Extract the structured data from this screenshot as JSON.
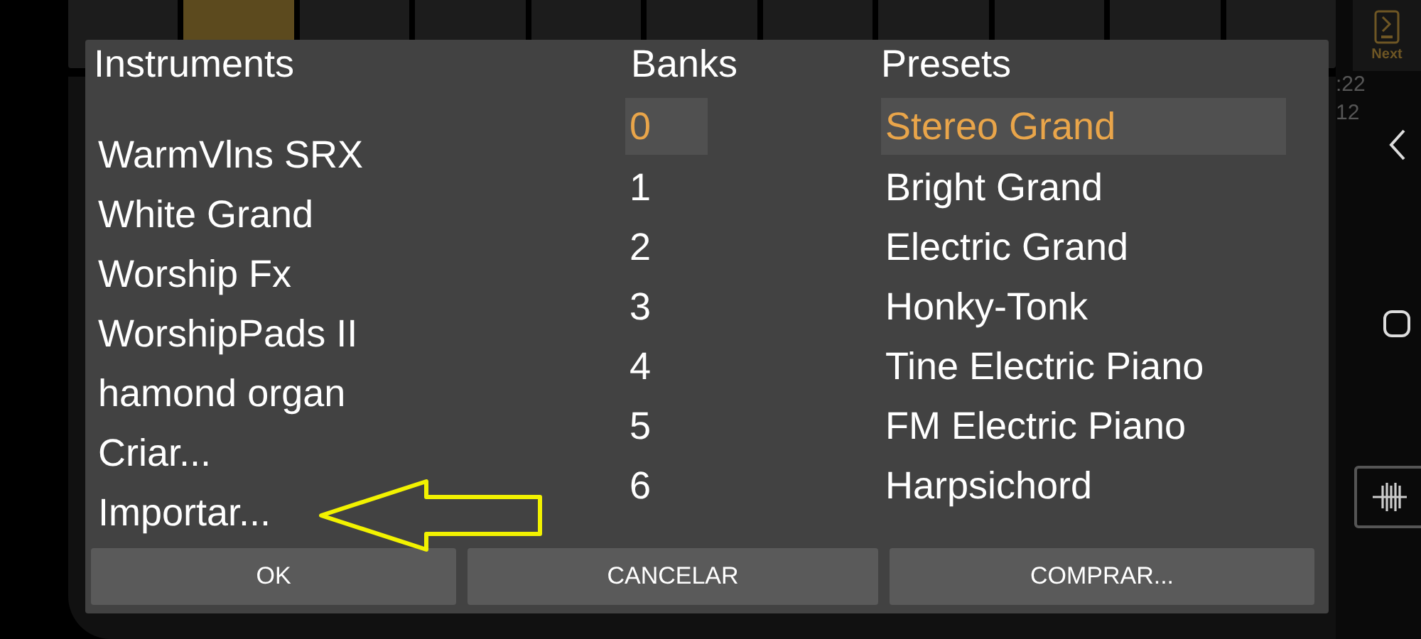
{
  "toolbar": {
    "buttons": [
      {
        "selected": false
      },
      {
        "selected": true
      },
      {
        "selected": false
      },
      {
        "selected": false
      },
      {
        "selected": false
      },
      {
        "selected": false
      },
      {
        "selected": false
      },
      {
        "selected": false
      },
      {
        "selected": false
      },
      {
        "selected": false
      },
      {
        "selected": false
      }
    ],
    "next_label": "Next"
  },
  "time": [
    ":22",
    "12"
  ],
  "dialog": {
    "columns": [
      {
        "title": "Instruments",
        "kind": "instrument",
        "items": [
          {
            "label": "WarmVlns SRX",
            "selected": false
          },
          {
            "label": "White Grand",
            "selected": false
          },
          {
            "label": "Worship Fx",
            "selected": false
          },
          {
            "label": "WorshipPads II",
            "selected": false
          },
          {
            "label": "hamond organ",
            "selected": false
          },
          {
            "label": "Criar...",
            "selected": false
          },
          {
            "label": "Importar...",
            "selected": false
          }
        ]
      },
      {
        "title": "Banks",
        "kind": "bank",
        "items": [
          {
            "label": "0",
            "selected": true
          },
          {
            "label": "1",
            "selected": false
          },
          {
            "label": "2",
            "selected": false
          },
          {
            "label": "3",
            "selected": false
          },
          {
            "label": "4",
            "selected": false
          },
          {
            "label": "5",
            "selected": false
          },
          {
            "label": "6",
            "selected": false
          }
        ]
      },
      {
        "title": "Presets",
        "kind": "preset",
        "items": [
          {
            "label": "Stereo Grand",
            "selected": true
          },
          {
            "label": "Bright Grand",
            "selected": false
          },
          {
            "label": "Electric Grand",
            "selected": false
          },
          {
            "label": "Honky-Tonk",
            "selected": false
          },
          {
            "label": "Tine Electric Piano",
            "selected": false
          },
          {
            "label": "FM Electric Piano",
            "selected": false
          },
          {
            "label": "Harpsichord",
            "selected": false
          }
        ]
      }
    ],
    "buttons": [
      "OK",
      "CANCELAR",
      "COMPRAR..."
    ]
  }
}
